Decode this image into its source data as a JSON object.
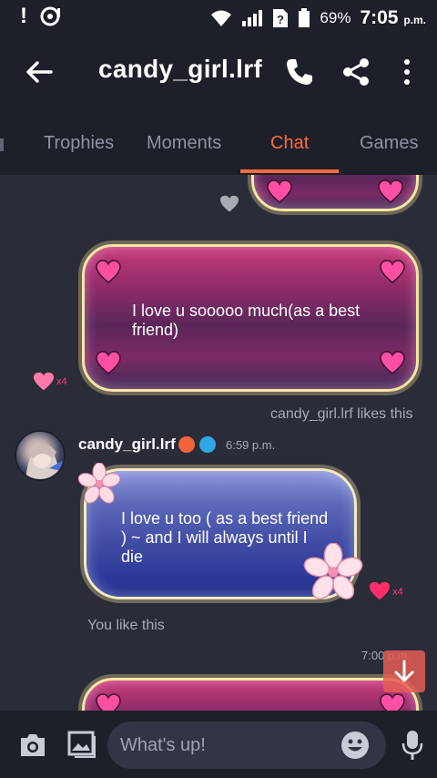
{
  "status_bar": {
    "battery": "69%",
    "time": "7:05",
    "ampm": "p.m."
  },
  "header": {
    "title": "candy_girl.lrf"
  },
  "tabs": [
    {
      "label": "Trophies",
      "active": false
    },
    {
      "label": "Moments",
      "active": false
    },
    {
      "label": "Chat",
      "active": true
    },
    {
      "label": "Games",
      "active": false
    }
  ],
  "messages": [
    {
      "text": "I love u sooooo much(as a best friend)",
      "likes": "x4"
    },
    {
      "likes_note": "candy_girl.lrf likes this"
    },
    {
      "sender": "candy_girl.lrf",
      "time": "6:59 p.m.",
      "text": "I love u too ( as a best friend ) ~ and I will always until I die",
      "likes": "x4",
      "likes_note": "You like this"
    },
    {
      "time": "7:00 p.m."
    }
  ],
  "composer": {
    "placeholder": "What's up!"
  },
  "colors": {
    "accent": "#ff6b3d",
    "heart": "#ff3d78",
    "header_bg": "#1d1f29",
    "chat_bg": "#2a2c38"
  }
}
